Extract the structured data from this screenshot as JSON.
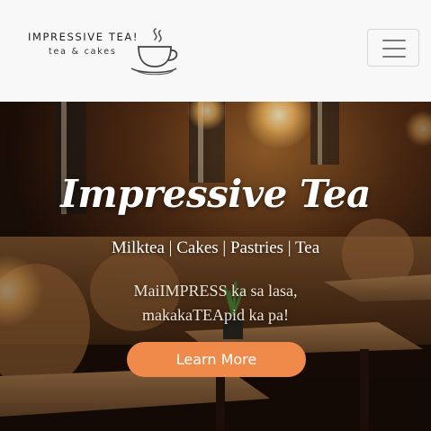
{
  "navbar": {
    "brand_name": "IMPRESSIVE TEA!",
    "brand_sub": "tea & cakes",
    "logo_icon": "teacup-icon",
    "menu_icon": "hamburger-menu-icon"
  },
  "hero": {
    "title": "Impressive Tea",
    "tagline": "Milktea | Cakes | Pastries | Tea",
    "slogan_line1": "MaiIMPRESS ka sa lasa,",
    "slogan_line2": "makakaTEApid ka pa!",
    "cta_label": "Learn More"
  },
  "colors": {
    "navbar_bg": "#f8f8f8",
    "cta_bg": "#f08a4b",
    "hero_text": "#ffffff"
  }
}
